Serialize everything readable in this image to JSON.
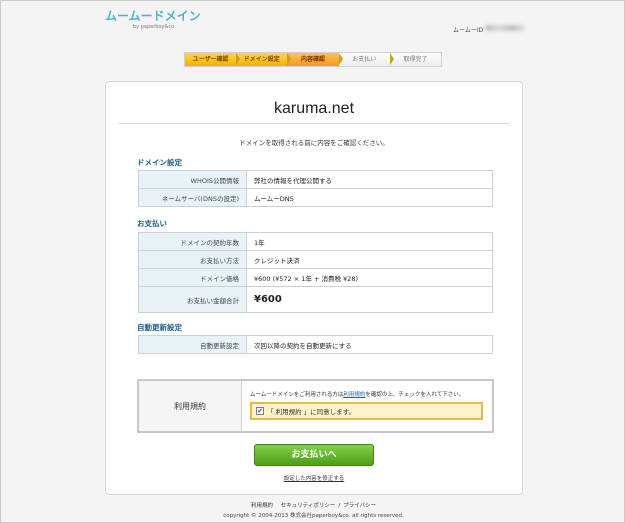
{
  "header": {
    "logo_main": "ムームードメイン",
    "logo_sub": "by paperboy&co.",
    "member_id_label": "ムームーID"
  },
  "steps": [
    {
      "label": "ユーザー確認",
      "state": "done"
    },
    {
      "label": "ドメイン設定",
      "state": "done"
    },
    {
      "label": "内容確認",
      "state": "current"
    },
    {
      "label": "お支払い",
      "state": "todo"
    },
    {
      "label": "取得完了",
      "state": "todo"
    }
  ],
  "domain": "karuma.net",
  "instruction": "ドメインを取得される前に内容をご確認ください。",
  "domain_settings": {
    "title": "ドメイン設定",
    "rows": [
      {
        "key": "WHOIS公開情報",
        "value": "弊社の情報を代理公開する"
      },
      {
        "key": "ネームサーバ(DNSの設定)",
        "value": "ムームーDNS"
      }
    ]
  },
  "payment": {
    "title": "お支払い",
    "rows": [
      {
        "key": "ドメインの契約年数",
        "value": "1年"
      },
      {
        "key": "お支払い方法",
        "value": "クレジット決済"
      },
      {
        "key": "ドメイン価格",
        "value": "¥600 (¥572 × 1年 + 消費税 ¥28)"
      },
      {
        "key": "お支払い金額合計",
        "value": "¥600"
      }
    ]
  },
  "auto_renew": {
    "title": "自動更新設定",
    "rows": [
      {
        "key": "自動更新設定",
        "value": "次回以降の契約を自動更新にする"
      }
    ]
  },
  "terms": {
    "label": "利用規約",
    "text_before": "ムームードメインをご利用される方は",
    "link": "利用規約",
    "text_after": "を確認の上、チェックを入れて下さい。",
    "agree": "「 利用規約 」に同意します。",
    "checked": true
  },
  "buttons": {
    "pay": "お支払いへ",
    "modify": "設定した内容を修正する"
  },
  "footer": {
    "links": [
      "利用規約",
      "セキュリティポリシー",
      "プライバシー"
    ],
    "copyright": "copyright © 2004-2013 株式会社paperboy&co. all rights reserved."
  },
  "colors": {
    "accent_green": "#5aab22",
    "section_title": "#1f5e86",
    "step_current": "#f39a1c",
    "step_done": "#f2b400"
  }
}
